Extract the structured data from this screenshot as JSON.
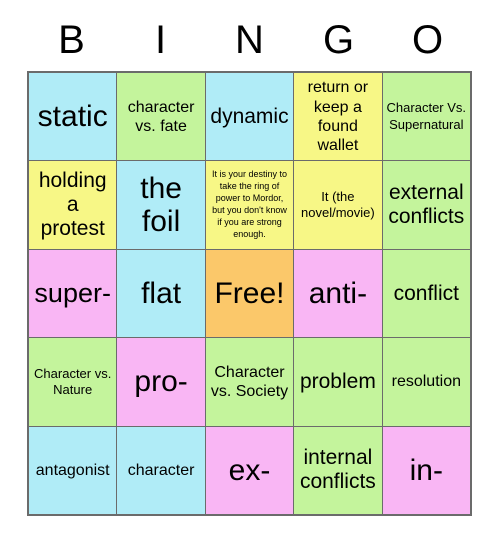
{
  "header": {
    "letters": [
      "B",
      "I",
      "N",
      "G",
      "O"
    ]
  },
  "colors": {
    "cyan": "#b0ecf7",
    "green": "#c4f49c",
    "yellow": "#f7f786",
    "orange": "#fbc86a",
    "pink": "#f9b6f4",
    "grid_line": "#6b6b6b",
    "text": "#000000",
    "background": "#ffffff"
  },
  "grid": {
    "rows": 5,
    "columns": 5,
    "cells": [
      {
        "text": "static",
        "color": "cyan",
        "size": "fs-xxl"
      },
      {
        "text": "character vs. fate",
        "color": "green",
        "size": "fs-md"
      },
      {
        "text": "dynamic",
        "color": "cyan",
        "size": "fs-lg"
      },
      {
        "text": "return or keep a found wallet",
        "color": "yellow",
        "size": "fs-md"
      },
      {
        "text": "Character Vs. Supernatural",
        "color": "green",
        "size": "fs-sm"
      },
      {
        "text": "holding a protest",
        "color": "yellow",
        "size": "fs-lg"
      },
      {
        "text": "the foil",
        "color": "cyan",
        "size": "fs-xxl"
      },
      {
        "text": "It is your destiny to take the ring of power to Mordor, but you don't know if you are strong enough.",
        "color": "yellow",
        "size": "fs-xs"
      },
      {
        "text": "It (the novel/movie)",
        "color": "yellow",
        "size": "fs-sm"
      },
      {
        "text": "external conflicts",
        "color": "green",
        "size": "fs-lg"
      },
      {
        "text": "super-",
        "color": "pink",
        "size": "fs-xl"
      },
      {
        "text": "flat",
        "color": "cyan",
        "size": "fs-xxl"
      },
      {
        "text": "Free!",
        "color": "orange",
        "size": "fs-xxl"
      },
      {
        "text": "anti-",
        "color": "pink",
        "size": "fs-xxl"
      },
      {
        "text": "conflict",
        "color": "green",
        "size": "fs-lg"
      },
      {
        "text": "Character vs. Nature",
        "color": "green",
        "size": "fs-sm"
      },
      {
        "text": "pro-",
        "color": "pink",
        "size": "fs-xxl"
      },
      {
        "text": "Character vs. Society",
        "color": "green",
        "size": "fs-md"
      },
      {
        "text": "problem",
        "color": "green",
        "size": "fs-lg"
      },
      {
        "text": "resolution",
        "color": "green",
        "size": "fs-md"
      },
      {
        "text": "antagonist",
        "color": "cyan",
        "size": "fs-md"
      },
      {
        "text": "character",
        "color": "cyan",
        "size": "fs-md"
      },
      {
        "text": "ex-",
        "color": "pink",
        "size": "fs-xxl"
      },
      {
        "text": "internal conflicts",
        "color": "green",
        "size": "fs-lg"
      },
      {
        "text": "in-",
        "color": "pink",
        "size": "fs-xxl"
      }
    ]
  }
}
